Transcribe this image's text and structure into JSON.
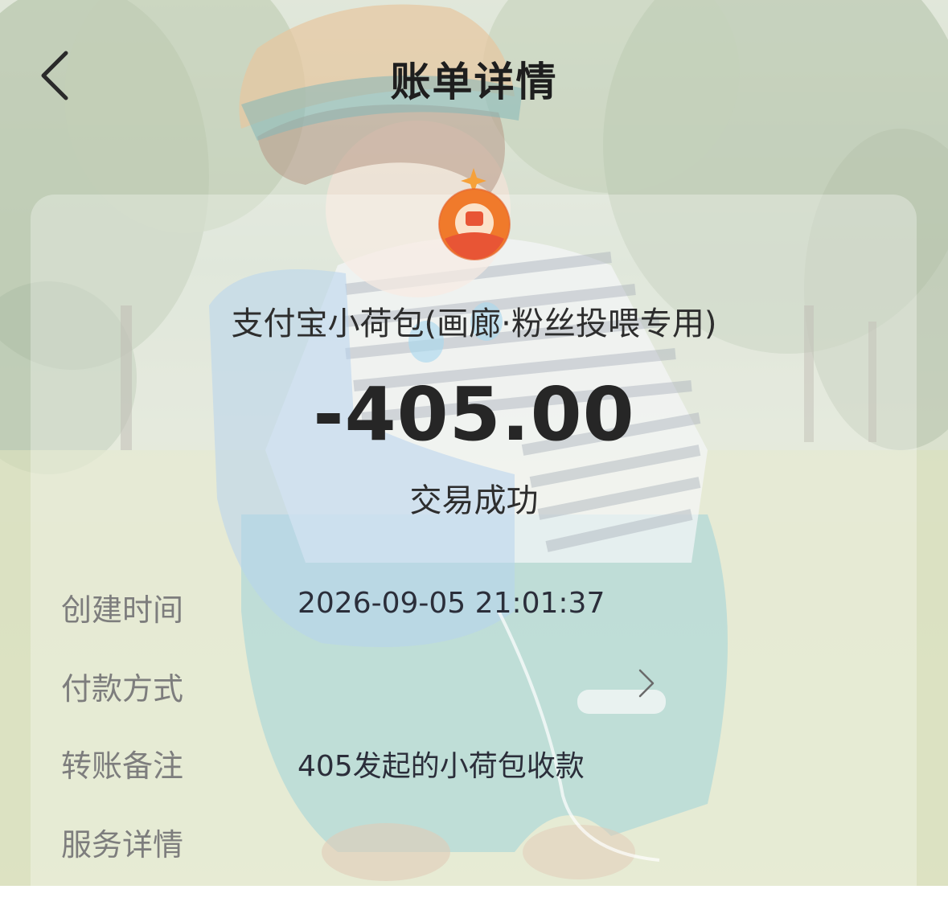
{
  "header": {
    "title": "账单详情",
    "back_icon": "chevron-left-icon"
  },
  "merchant": {
    "logo_icon": "money-pouch-icon",
    "name": "支付宝小荷包(画廊·粉丝投喂专用)"
  },
  "transaction": {
    "amount": "-405.00",
    "status": "交易成功"
  },
  "details": [
    {
      "label": "创建时间",
      "value": "2026-09-05  21:01:37"
    },
    {
      "label": "付款方式",
      "value": "",
      "has_chevron": true
    },
    {
      "label": "转账备注",
      "value": "405发起的小荷包收款"
    },
    {
      "label": "服务详情",
      "value": ""
    }
  ],
  "colors": {
    "logo_orange": "#f07a2b",
    "logo_red": "#e85535",
    "logo_star": "#f6a13a"
  }
}
